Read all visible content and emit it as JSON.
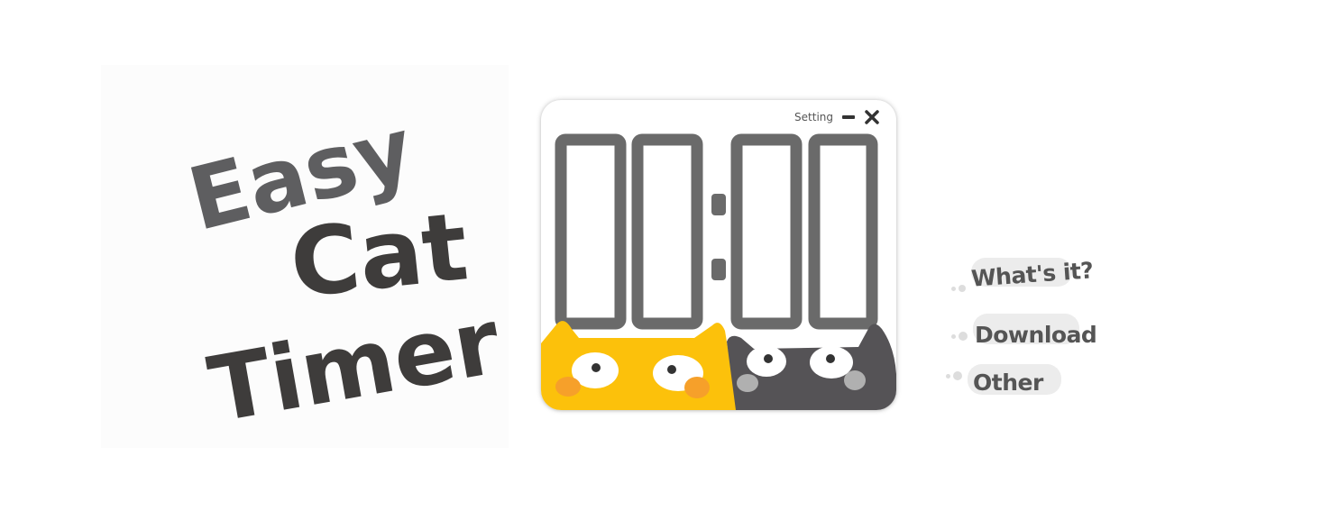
{
  "logo": {
    "line1": "Easy",
    "line2": "Cat",
    "line3": "Timer"
  },
  "timer": {
    "setting_label": "Setting",
    "minimize_icon": "minimize-icon",
    "close_icon": "close-icon",
    "display": {
      "minutes_tens": "0",
      "minutes_ones": "0",
      "separator": ":",
      "seconds_tens": "0",
      "seconds_ones": "0"
    },
    "cats": [
      {
        "name": "yellow-cat",
        "color": "#fcc10b"
      },
      {
        "name": "gray-cat",
        "color": "#555356"
      }
    ]
  },
  "menu": {
    "items": [
      {
        "label": "What's it?"
      },
      {
        "label": "Download"
      },
      {
        "label": "Other"
      }
    ]
  },
  "colors": {
    "ink": "#5e5e60",
    "ink_dark": "#3e3c3b",
    "digit": "#6a6a6a",
    "yellow": "#fcc10b",
    "orange_cheek": "#f6a02a",
    "gray_cat": "#555356",
    "pill": "#ececec"
  }
}
